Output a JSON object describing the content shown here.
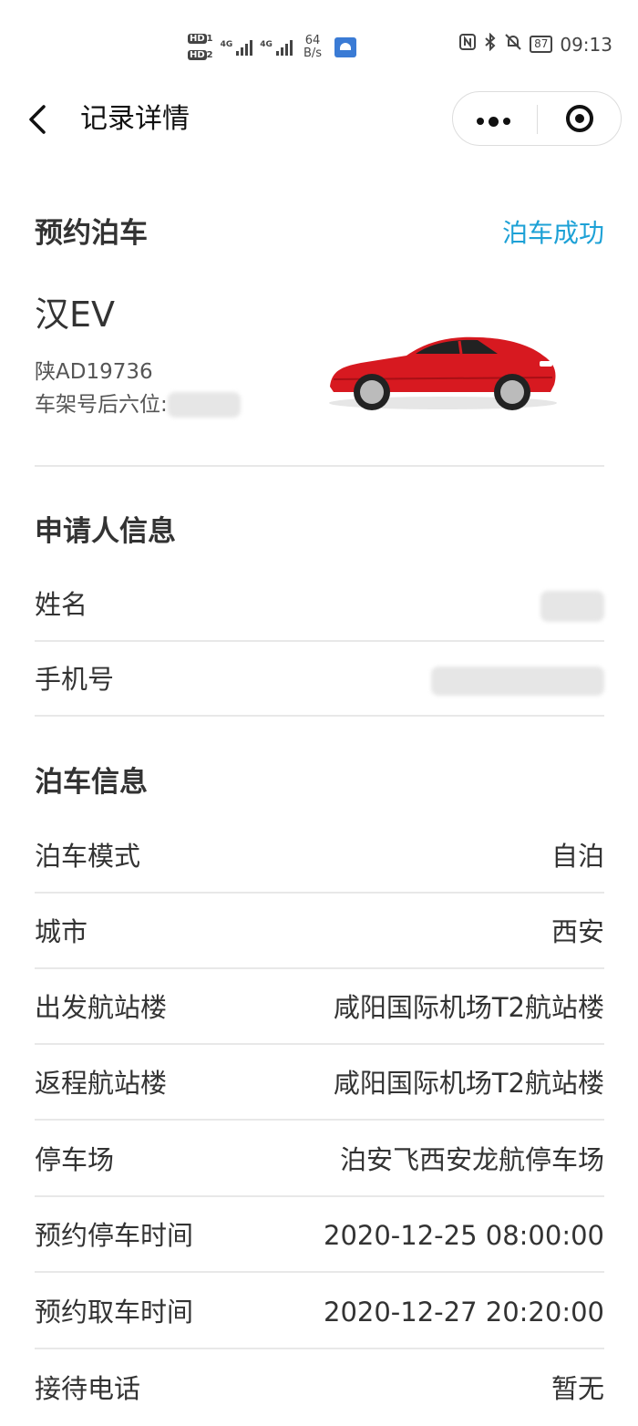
{
  "status_bar": {
    "hd1": "HD",
    "hd2": "HD",
    "net1": "4G",
    "net2": "4G",
    "speed_value": "64",
    "speed_unit": "B/s",
    "battery": "87",
    "time": "09:13",
    "icons": [
      "nfc-icon",
      "bluetooth-icon",
      "bell-off-icon",
      "battery-icon"
    ]
  },
  "nav": {
    "title": "记录详情",
    "back_icon": "chevron-left-icon",
    "more_icon": "more-dots-icon",
    "close_icon": "target-close-icon"
  },
  "booking": {
    "title": "预约泊车",
    "status": "泊车成功",
    "car_model": "汉EV",
    "plate": "陕AD19736",
    "vin_label": "车架号后六位:",
    "car_image": "red-sedan-image"
  },
  "applicant": {
    "title": "申请人信息",
    "rows": [
      {
        "label": "姓名"
      },
      {
        "label": "手机号"
      }
    ]
  },
  "parking": {
    "title": "泊车信息",
    "rows": [
      {
        "label": "泊车模式",
        "value": "自泊"
      },
      {
        "label": "城市",
        "value": "西安"
      },
      {
        "label": "出发航站楼",
        "value": "咸阳国际机场T2航站楼"
      },
      {
        "label": "返程航站楼",
        "value": "咸阳国际机场T2航站楼"
      },
      {
        "label": "停车场",
        "value": "泊安飞西安龙航停车场"
      },
      {
        "label": "预约停车时间",
        "value": "2020-12-25 08:00:00"
      },
      {
        "label": "预约取车时间",
        "value": "2020-12-27 20:20:00"
      },
      {
        "label": "接待电话",
        "value": "暂无"
      }
    ]
  },
  "colors": {
    "accent": "#1da1d6",
    "divider": "#e8e8e8",
    "text": "#333333",
    "car": "#d71920"
  }
}
